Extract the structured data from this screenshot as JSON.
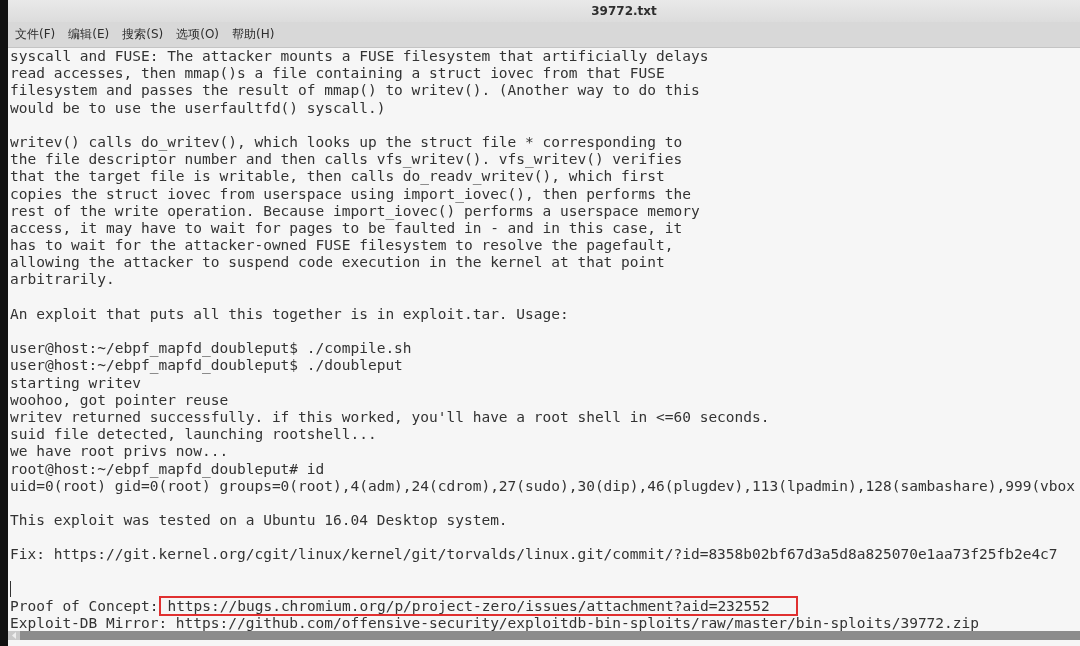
{
  "window": {
    "title": "39772.txt"
  },
  "menu": [
    {
      "label": "文件(F)"
    },
    {
      "label": "编辑(E)"
    },
    {
      "label": "搜索(S)"
    },
    {
      "label": "选项(O)"
    },
    {
      "label": "帮助(H)"
    }
  ],
  "editor": {
    "lines": [
      {
        "kind": "text",
        "text": "syscall and FUSE: The attacker mounts a FUSE filesystem that artificially delays"
      },
      {
        "kind": "text",
        "text": "read accesses, then mmap()s a file containing a struct iovec from that FUSE"
      },
      {
        "kind": "text",
        "text": "filesystem and passes the result of mmap() to writev(). (Another way to do this"
      },
      {
        "kind": "text",
        "text": "would be to use the userfaultfd() syscall.)"
      },
      {
        "kind": "blank"
      },
      {
        "kind": "text",
        "text": "writev() calls do_writev(), which looks up the struct file * corresponding to"
      },
      {
        "kind": "text",
        "text": "the file descriptor number and then calls vfs_writev(). vfs_writev() verifies"
      },
      {
        "kind": "text",
        "text": "that the target file is writable, then calls do_readv_writev(), which first"
      },
      {
        "kind": "text",
        "text": "copies the struct iovec from userspace using import_iovec(), then performs the"
      },
      {
        "kind": "text",
        "text": "rest of the write operation. Because import_iovec() performs a userspace memory"
      },
      {
        "kind": "text",
        "text": "access, it may have to wait for pages to be faulted in - and in this case, it"
      },
      {
        "kind": "text",
        "text": "has to wait for the attacker-owned FUSE filesystem to resolve the pagefault,"
      },
      {
        "kind": "text",
        "text": "allowing the attacker to suspend code execution in the kernel at that point"
      },
      {
        "kind": "text",
        "text": "arbitrarily."
      },
      {
        "kind": "blank"
      },
      {
        "kind": "text",
        "text": "An exploit that puts all this together is in exploit.tar. Usage:"
      },
      {
        "kind": "blank"
      },
      {
        "kind": "text",
        "text": "user@host:~/ebpf_mapfd_doubleput$ ./compile.sh"
      },
      {
        "kind": "text",
        "text": "user@host:~/ebpf_mapfd_doubleput$ ./doubleput"
      },
      {
        "kind": "text",
        "text": "starting writev"
      },
      {
        "kind": "text",
        "text": "woohoo, got pointer reuse"
      },
      {
        "kind": "text",
        "text": "writev returned successfully. if this worked, you'll have a root shell in <=60 seconds."
      },
      {
        "kind": "text",
        "text": "suid file detected, launching rootshell..."
      },
      {
        "kind": "text",
        "text": "we have root privs now..."
      },
      {
        "kind": "text",
        "text": "root@host:~/ebpf_mapfd_doubleput# id"
      },
      {
        "kind": "text",
        "text": "uid=0(root) gid=0(root) groups=0(root),4(adm),24(cdrom),27(sudo),30(dip),46(plugdev),113(lpadmin),128(sambashare),999(vbox"
      },
      {
        "kind": "blank"
      },
      {
        "kind": "text",
        "text": "This exploit was tested on a Ubuntu 16.04 Desktop system."
      },
      {
        "kind": "blank"
      },
      {
        "kind": "text",
        "text": "Fix: https://git.kernel.org/cgit/linux/kernel/git/torvalds/linux.git/commit/?id=8358b02bf67d3a5d8a825070e1aa73f25fb2e4c7"
      },
      {
        "kind": "blank"
      },
      {
        "kind": "cursor"
      },
      {
        "kind": "boxed",
        "text": "Proof of Concept:",
        "boxed_text": "https://bugs.chromium.org/p/project-zero/issues/attachment?aid=232552"
      },
      {
        "kind": "text",
        "text": "Exploit-DB Mirror: https://github.com/offensive-security/exploitdb-bin-sploits/raw/master/bin-sploits/39772.zip"
      }
    ]
  }
}
